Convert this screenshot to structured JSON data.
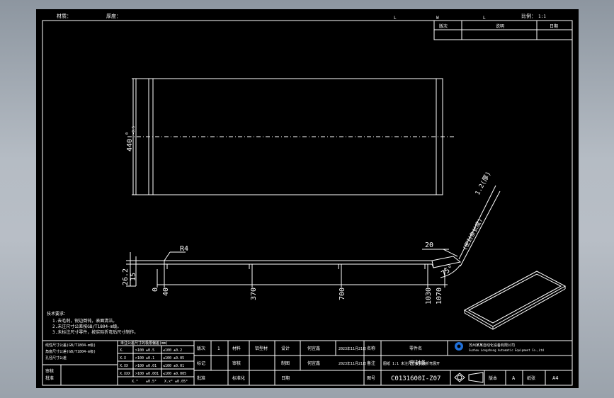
{
  "colors": {
    "canvas": "#000000",
    "line": "#ffffff",
    "outer_background": "#a3aab2"
  },
  "header": {
    "left_a": "材质：",
    "left_b": "厚度：",
    "mark_l1": "L",
    "mark_w": "W",
    "mark_l2": "L",
    "right_scale": "比例：",
    "right_num": "1:1"
  },
  "revision_table": {
    "headers": [
      "版次",
      "说明",
      "日期"
    ]
  },
  "dimensions": {
    "height_value": "440",
    "height_tolerance_top": "0",
    "height_tolerance_bottom": "-0.5",
    "radius_label": "R4",
    "left_thickness_a": "26.2",
    "left_thickness_b": "15",
    "bottom_positions": [
      "0",
      "40",
      "370",
      "700",
      "1030",
      "1070"
    ],
    "angle": "75°",
    "flange": "20",
    "seal_note": "(密封条长度)",
    "seal_length": "1.2(厚)"
  },
  "notes": {
    "title": "技术要求：",
    "line1": "1.去毛刺，锐边倒钝，表面清洁。",
    "line2": "2.未注尺寸公差按GB/T1804-m级。",
    "line3": "3.未标注尺寸零件，按实际折弯后尺寸制作。"
  },
  "tolerance_block": {
    "head": "未注公差尺寸的极限偏差(mm)",
    "row1_label": "线性尺寸公差(GB/T1804-m级)",
    "row2_label": "角度尺寸公差(GB/T1804-m级)",
    "row3_label": "孔径尺寸公差",
    "bottom_label_a": "审核",
    "bottom_label_b": "批准",
    "rows": [
      [
        "X.",
        ">100 ±0.5",
        "≤100 ±0.2"
      ],
      [
        "X.X",
        ">100 ±0.1",
        "≤100 ±0.05"
      ],
      [
        "X.XX",
        ">100 ±0.01",
        "≤100 ±0.01"
      ],
      [
        "X.XXX",
        ">100 ±0.001",
        "≤100 ±0.005"
      ],
      [
        "X.°",
        "±0.5°",
        "X.x° ±0.05°"
      ]
    ]
  },
  "title_block": {
    "c1": "版次",
    "c2": "1",
    "c3": "材料",
    "c4": "铝型材",
    "c5": "设计",
    "c6": "何宜鑫",
    "c7": "2023年11月21日",
    "c8": "名称",
    "part_name_label": "零件名",
    "part_name": "密封条",
    "c9": "标记",
    "c10": "审核",
    "c11": "制图",
    "c12": "何宜鑫",
    "c13": "2023年11月21日",
    "c14": "备注",
    "note_text": "图纸 1:1 未注尺寸按实际折弯展开",
    "c15": "批准",
    "c16": "标准化",
    "c17": "日期",
    "c18": "图号",
    "drawing_no": "C0131600I-Z07",
    "company": "苏州某某自动化设备有限公司",
    "company_en": "Suzhou Longsheng Automatic Equipment Co.,Ltd",
    "version_label": "版本",
    "version": "A",
    "sheet_label": "纸张",
    "sheet": "A4"
  }
}
